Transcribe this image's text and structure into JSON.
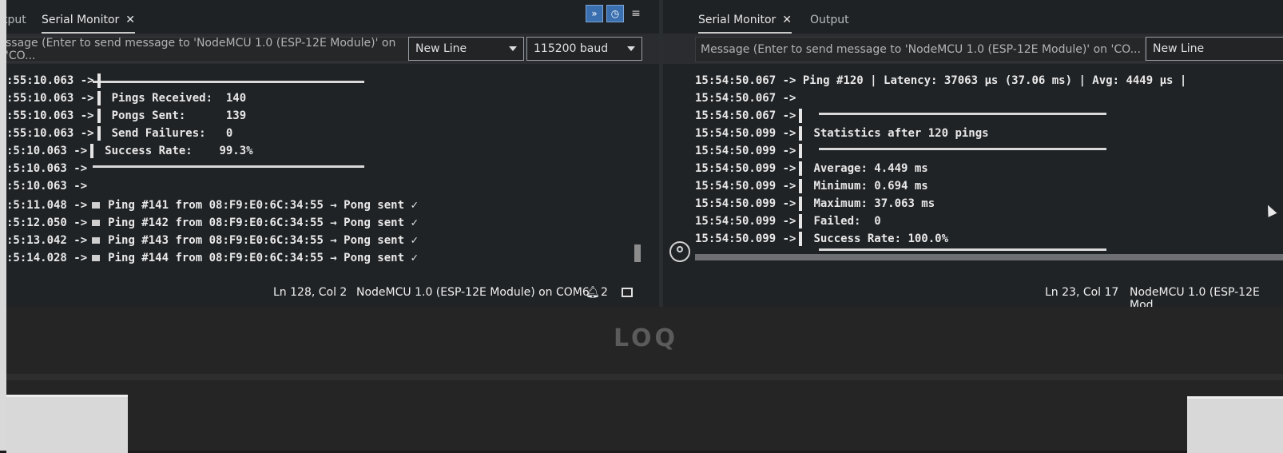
{
  "left": {
    "tabs": [
      {
        "label": "tput",
        "active": false
      },
      {
        "label": "Serial Monitor",
        "active": true
      }
    ],
    "message_placeholder": "ssage (Enter to send message to 'NodeMCU 1.0 (ESP-12E Module)' on 'CO...",
    "line_ending": "New Line",
    "baud": "115200 baud",
    "toolbar_icons": [
      "chevrons-down-icon",
      "clock-icon",
      "menu-lines-icon"
    ],
    "lines": [
      {
        "ts": ":55:10.063 ->",
        "text": ""
      },
      {
        "ts": ":55:10.063 ->",
        "text": "Pings Received:  140"
      },
      {
        "ts": ":55:10.063 ->",
        "text": "Pongs Sent:      139"
      },
      {
        "ts": ":55:10.063 ->",
        "text": "Send Failures:   0"
      },
      {
        "ts": ":5:10.063 ->",
        "text": "Success Rate:    99.3%"
      },
      {
        "ts": ":5:10.063 ->",
        "text": ""
      },
      {
        "ts": ":5:10.063 ->",
        "text": ""
      },
      {
        "ts": ":5:11.048 ->",
        "text": "Ping #141 from 08:F9:E0:6C:34:55 → Pong sent ✓"
      },
      {
        "ts": ":5:12.050 ->",
        "text": "Ping #142 from 08:F9:E0:6C:34:55 → Pong sent ✓"
      },
      {
        "ts": ":5:13.042 ->",
        "text": "Ping #143 from 08:F9:E0:6C:34:55 → Pong sent ✓"
      },
      {
        "ts": ":5:14.028 ->",
        "text": "Ping #144 from 08:F9:E0:6C:34:55 → Pong sent ✓"
      }
    ],
    "status": {
      "position": "Ln 128, Col 2",
      "board": "NodeMCU 1.0 (ESP-12E Module) on COM6",
      "notifications": "2"
    }
  },
  "right": {
    "tabs": [
      {
        "label": "Serial Monitor",
        "active": true
      },
      {
        "label": "Output",
        "active": false
      }
    ],
    "message_placeholder": "Message (Enter to send message to 'NodeMCU 1.0 (ESP-12E Module)' on 'CO...",
    "line_ending": "New Line",
    "lines": [
      {
        "ts": "15:54:50.067 ->",
        "text": "Ping #120 | Latency: 37063 µs (37.06 ms) | Avg: 4449 µs |"
      },
      {
        "ts": "15:54:50.067 ->",
        "text": ""
      },
      {
        "ts": "15:54:50.067 ->",
        "text": ""
      },
      {
        "ts": "15:54:50.099 ->",
        "text": "Statistics after 120 pings"
      },
      {
        "ts": "15:54:50.099 ->",
        "text": ""
      },
      {
        "ts": "15:54:50.099 ->",
        "text": "Average: 4.449 ms"
      },
      {
        "ts": "15:54:50.099 ->",
        "text": "Minimum: 0.694 ms"
      },
      {
        "ts": "15:54:50.099 ->",
        "text": "Maximum: 37.063 ms"
      },
      {
        "ts": "15:54:50.099 ->",
        "text": "Failed:  0"
      },
      {
        "ts": "15:54:50.099 ->",
        "text": "Success Rate: 100.0%"
      }
    ],
    "status": {
      "position": "Ln 23, Col 17",
      "board": "NodeMCU 1.0 (ESP-12E Mod"
    }
  },
  "bezel": {
    "logo": "LOQ"
  }
}
